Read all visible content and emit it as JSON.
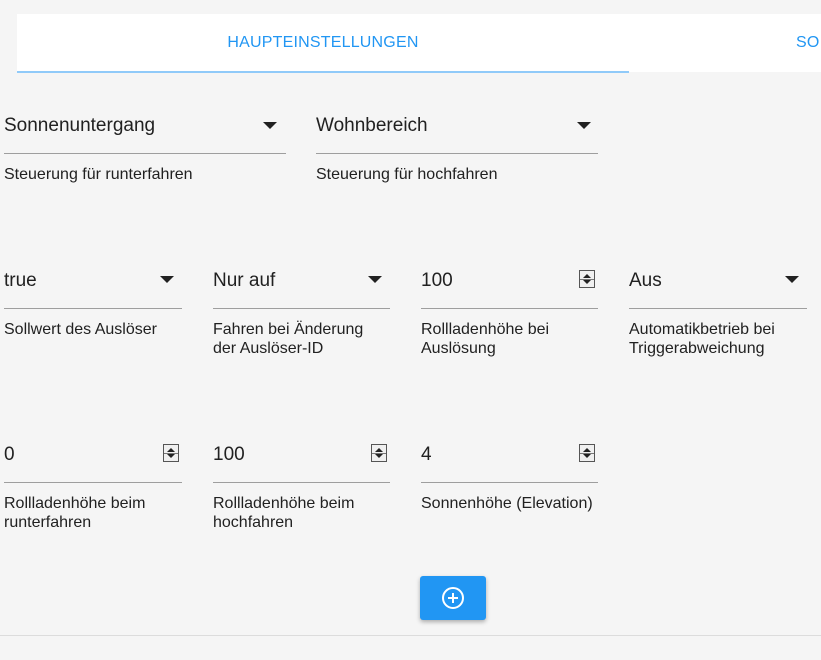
{
  "tabs": {
    "main_label": "HAUPTEINSTELLUNGEN",
    "other_label": "SO"
  },
  "row1": {
    "down_control": {
      "value": "Sonnenuntergang",
      "label": "Steuerung für runterfahren"
    },
    "up_control": {
      "value": "Wohnbereich",
      "label": "Steuerung für hochfahren"
    }
  },
  "row2": {
    "trigger_value": {
      "value": "true",
      "label": "Sollwert des Auslöser"
    },
    "trigger_id_change": {
      "value": "Nur auf",
      "label_line1": "Fahren bei Änderung",
      "label_line2": "der Auslöser-ID"
    },
    "trigger_height": {
      "value": "100",
      "label_line1": "Rollladenhöhe bei",
      "label_line2": "Auslösung"
    },
    "auto_mode": {
      "value": "Aus",
      "label_line1": "Automatikbetrieb bei",
      "label_line2": "Triggerabweichung"
    }
  },
  "row3": {
    "height_down": {
      "value": "0",
      "label_line1": "Rollladenhöhe beim",
      "label_line2": "runterfahren"
    },
    "height_up": {
      "value": "100",
      "label_line1": "Rollladenhöhe beim",
      "label_line2": "hochfahren"
    },
    "elevation": {
      "value": "4",
      "label": "Sonnenhöhe (Elevation)"
    }
  },
  "add_button": {
    "icon": "add-circle-icon"
  },
  "colors": {
    "accent": "#2196f3",
    "tab_indicator": "#90caf9",
    "background": "#f5f5f5"
  }
}
